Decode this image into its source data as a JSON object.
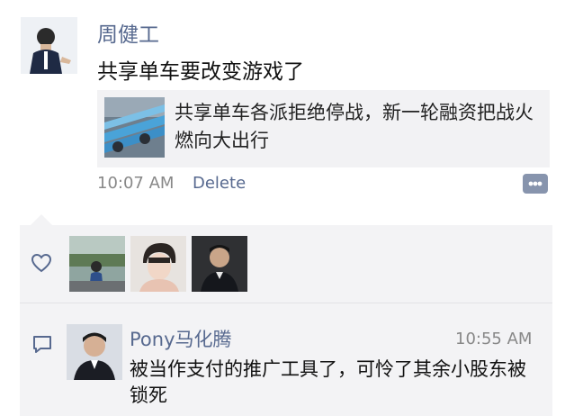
{
  "post": {
    "author": "周健工",
    "text": "共享单车要改变游戏了",
    "link_title": "共享单车各派拒绝停战，新一轮融资把战火燃向大出行",
    "time": "10:07 AM",
    "delete_label": "Delete"
  },
  "likes": {
    "icon": "heart-icon",
    "avatars": [
      "avatar-1",
      "avatar-2",
      "avatar-3"
    ]
  },
  "comment": {
    "author": "Pony马化腾",
    "time": "10:55 AM",
    "text": "被当作支付的推广工具了，可怜了其余小股东被锁死"
  },
  "colors": {
    "name_blue": "#57698f",
    "panel_bg": "#f3f3f5",
    "link_bg": "#f2f2f4",
    "meta_gray": "#888888"
  }
}
